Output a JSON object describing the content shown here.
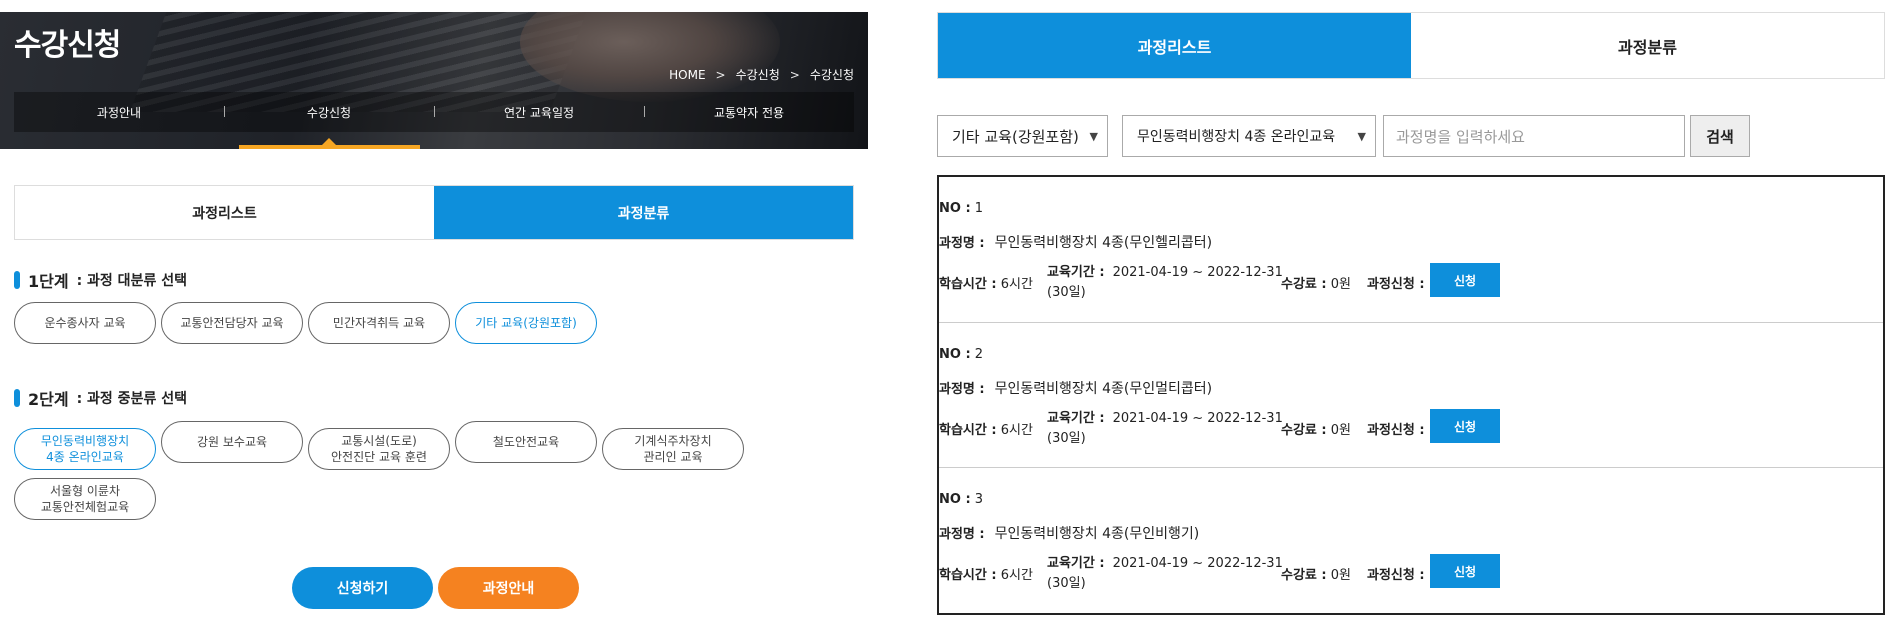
{
  "left": {
    "hero_title": "수강신청",
    "breadcrumb": [
      "HOME",
      "수강신청",
      "수강신청"
    ],
    "nav": [
      "과정안내",
      "수강신청",
      "연간 교육일정",
      "교통약자 전용"
    ],
    "tabs": [
      "과정리스트",
      "과정분류"
    ],
    "step1": {
      "num": "1단계",
      "label": ": 과정 대분류 선택"
    },
    "step1_options": [
      "운수종사자 교육",
      "교통안전담당자 교육",
      "민간자격취득 교육",
      "기타 교육(강원포함)"
    ],
    "step2": {
      "num": "2단계",
      "label": ": 과정 중분류 선택"
    },
    "step2_options": [
      [
        "무인동력비행장치",
        "4종 온라인교육"
      ],
      [
        "강원 보수교육"
      ],
      [
        "교통시설(도로)",
        "안전진단 교육 훈련"
      ],
      [
        "철도안전교육"
      ],
      [
        "기계식주차장치",
        "관리인 교육"
      ],
      [
        "서울형 이륜차",
        "교통안전체험교육"
      ]
    ],
    "apply_button": "신청하기",
    "guide_button": "과정안내"
  },
  "right": {
    "tabs": [
      "과정리스트",
      "과정분류"
    ],
    "filter1": "기타 교육(강원포함)",
    "filter2": "무인동력비행장치 4종 온라인교육",
    "search_placeholder": "과정명을 입력하세요",
    "search_button": "검색",
    "labels": {
      "no": "NO :",
      "course": "과정명 :",
      "hours": "학습시간 :",
      "period": "교육기간 :",
      "fee": "수강료 :",
      "apply": "과정신청 :"
    },
    "courses": [
      {
        "no": "1",
        "name": "무인동력비행장치 4종(무인헬리콥터)",
        "hours": "6시간",
        "period": "2021-04-19 ~ 2022-12-31",
        "days": "(30일)",
        "fee": "0원",
        "button": "신청"
      },
      {
        "no": "2",
        "name": "무인동력비행장치 4종(무인멀티콥터)",
        "hours": "6시간",
        "period": "2021-04-19 ~ 2022-12-31",
        "days": "(30일)",
        "fee": "0원",
        "button": "신청"
      },
      {
        "no": "3",
        "name": "무인동력비행장치 4종(무인비행기)",
        "hours": "6시간",
        "period": "2021-04-19 ~ 2022-12-31",
        "days": "(30일)",
        "fee": "0원",
        "button": "신청"
      }
    ]
  },
  "colors": {
    "accent": "#0e8fdb",
    "orange": "#f58220",
    "nav_indicator": "#f6a623"
  }
}
